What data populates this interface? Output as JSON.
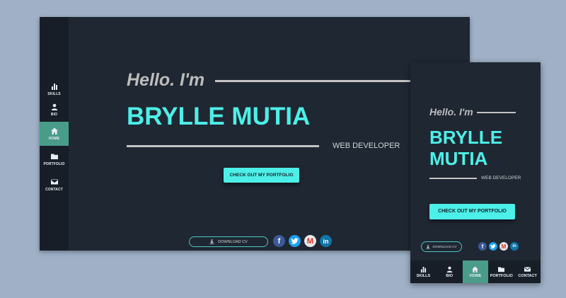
{
  "nav": {
    "items": [
      {
        "icon": "bar-chart-icon",
        "label": "SKILLS"
      },
      {
        "icon": "person-icon",
        "label": "BIO"
      },
      {
        "icon": "home-icon",
        "label": "HOME"
      },
      {
        "icon": "folder-icon",
        "label": "PORTFOLIO"
      },
      {
        "icon": "mail-icon",
        "label": "CONTACT"
      }
    ],
    "active": "HOME"
  },
  "hero": {
    "greeting": "Hello. I'm",
    "name": "BRYLLE MUTIA",
    "name_line1": "BRYLLE",
    "name_line2": "MUTIA",
    "role": "WEB DEVELOPER",
    "cta_label": "CHECK OUT MY PORTFOLIO"
  },
  "footer": {
    "download_label": "DOWNLOAD CV",
    "social": [
      {
        "icon": "facebook-icon",
        "glyph": "f"
      },
      {
        "icon": "twitter-icon",
        "glyph": ""
      },
      {
        "icon": "gmail-icon",
        "glyph": "M"
      },
      {
        "icon": "linkedin-icon",
        "glyph": "in"
      }
    ]
  },
  "colors": {
    "background": "#9fb0c7",
    "panel": "#1f2732",
    "sidebar": "#181e27",
    "accent": "#4cf0e8",
    "active_nav": "#4a9c8a"
  }
}
